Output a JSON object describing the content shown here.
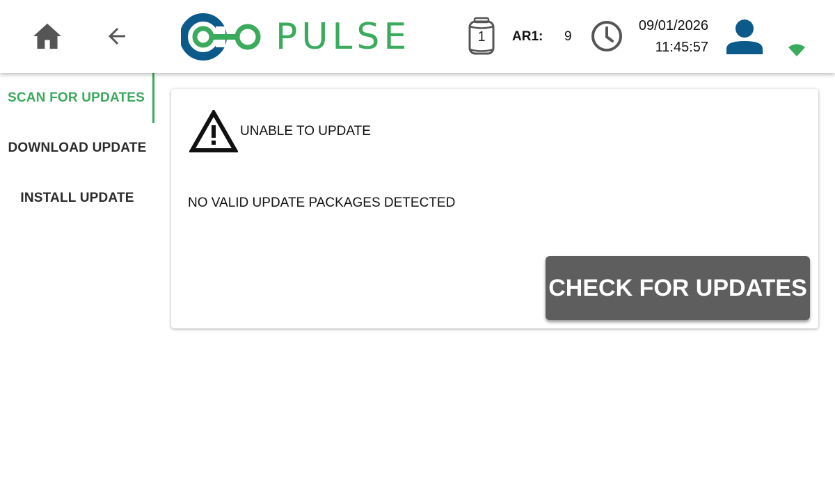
{
  "header": {
    "brand_name": "PULSE",
    "device_count": "1",
    "ar_label": "AR1:",
    "ar_value": "9",
    "date": "09/01/2026",
    "time": "11:45:57",
    "icons": {
      "home": "home-icon",
      "back": "arrow-left-icon",
      "device": "canister-icon",
      "clock": "clock-icon",
      "user": "user-icon",
      "wifi": "wifi-icon"
    }
  },
  "sidebar": {
    "items": [
      {
        "label": "SCAN FOR UPDATES",
        "active": true
      },
      {
        "label": "DOWNLOAD UPDATE",
        "active": false
      },
      {
        "label": "INSTALL UPDATE",
        "active": false
      }
    ]
  },
  "main": {
    "status_title": "UNABLE TO UPDATE",
    "status_message": "NO VALID UPDATE PACKAGES DETECTED",
    "check_button_label": "CHECK FOR UPDATES",
    "status_icon": "warning-triangle-icon"
  },
  "colors": {
    "brand_green": "#3aaa5c",
    "brand_blue": "#0b5a8a",
    "icon_gray": "#555555",
    "button_gray": "#5e5e5e"
  }
}
